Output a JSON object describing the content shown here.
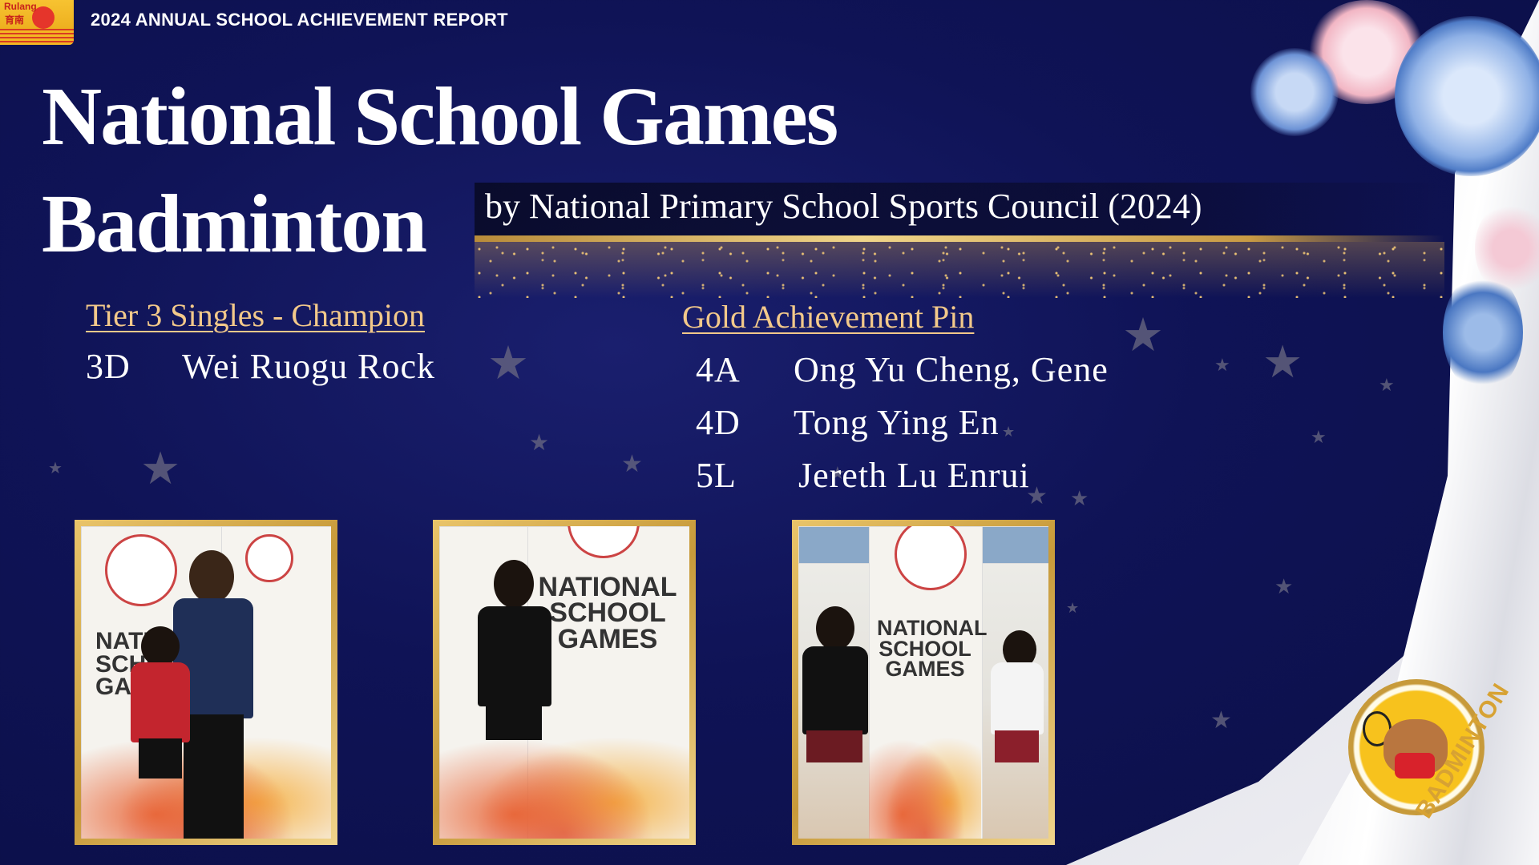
{
  "header": {
    "logo_text": "Rulang",
    "logo_chinese": "育南",
    "report_title": "2024 ANNUAL SCHOOL ACHIEVEMENT REPORT"
  },
  "title": {
    "line1": "National School Games",
    "line2": "Badminton",
    "byline": "by National Primary School Sports Council (2024)"
  },
  "champion": {
    "heading": "Tier 3 Singles - Champion",
    "entries": [
      {
        "class": "3D",
        "name": "Wei Ruogu Rock"
      }
    ]
  },
  "gold_pin": {
    "heading": "Gold Achievement Pin",
    "entries": [
      {
        "class": "4A",
        "name": "Ong Yu Cheng, Gene"
      },
      {
        "class": "4D",
        "name": "Tong Ying En"
      },
      {
        "class": "5L",
        "name": "Jereth Lu Enrui"
      }
    ]
  },
  "photos": {
    "banner_text": "NATIONAL SCHOOL GAMES",
    "banner_partial": "NATIO SCHO GA"
  },
  "badge": {
    "label": "BADMINTON"
  },
  "colors": {
    "background": "#0f1356",
    "heading_gold": "#f3c98a",
    "frame_gold": "#c79a3a"
  }
}
